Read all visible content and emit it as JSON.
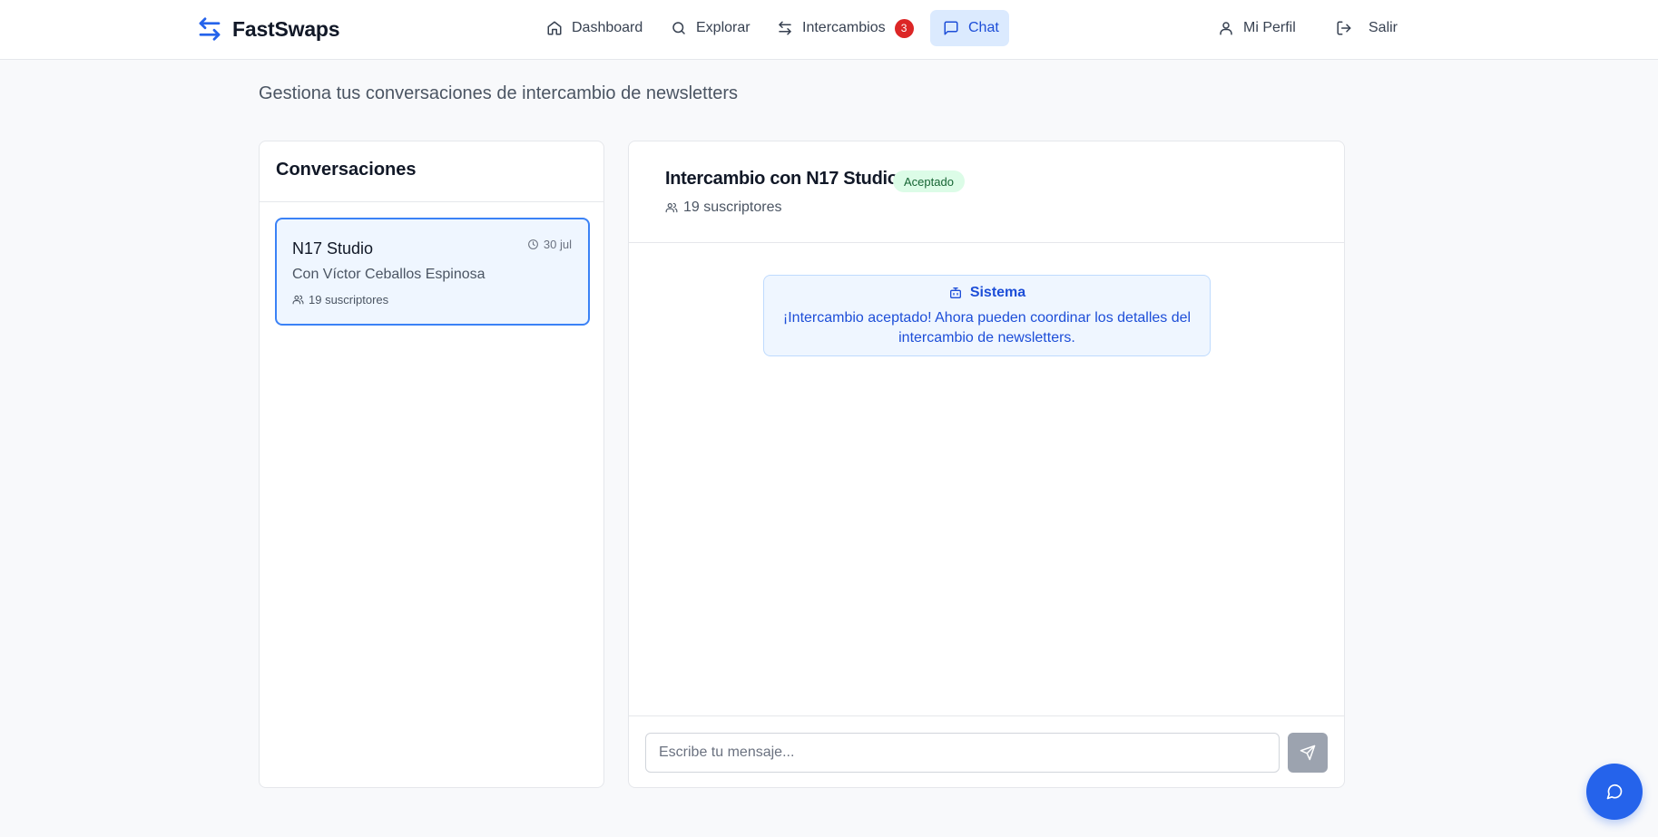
{
  "app": {
    "name": "FastSwaps",
    "accent": "#2563eb"
  },
  "nav": {
    "items": [
      {
        "label": "Dashboard",
        "icon": "home-icon"
      },
      {
        "label": "Explorar",
        "icon": "search-icon"
      },
      {
        "label": "Intercambios",
        "icon": "swap-icon",
        "badge": "3"
      },
      {
        "label": "Chat",
        "icon": "message-square-icon",
        "active": true
      }
    ],
    "profile_label": "Mi Perfil",
    "logout_label": "Salir"
  },
  "page": {
    "subtitle": "Gestiona tus conversaciones de intercambio de newsletters"
  },
  "conversations": {
    "title": "Conversaciones",
    "items": [
      {
        "name": "N17 Studio",
        "date": "30 jul",
        "with": "Con Víctor Ceballos Espinosa",
        "subscribers": "19 suscriptores"
      }
    ]
  },
  "chat": {
    "title": "Intercambio con N17 Studio",
    "status": "Aceptado",
    "status_color": "#166534",
    "subscribers": "19 suscriptores",
    "messages": [
      {
        "sender": "Sistema",
        "text": "¡Intercambio aceptado! Ahora pueden coordinar los detalles del intercambio de newsletters."
      }
    ],
    "input_placeholder": "Escribe tu mensaje...",
    "input_value": ""
  }
}
